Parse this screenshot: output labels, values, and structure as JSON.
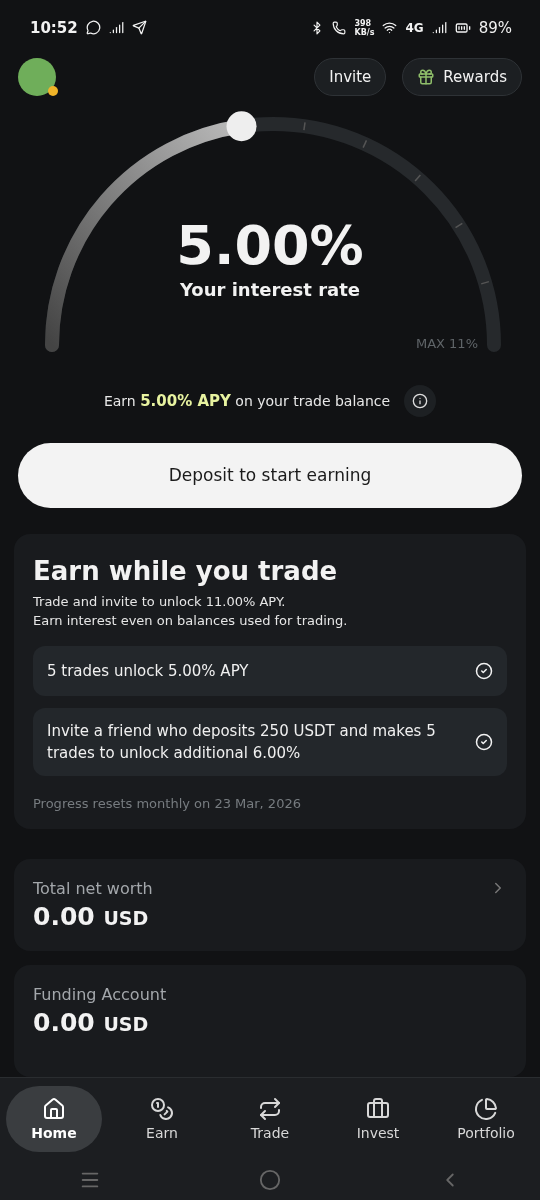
{
  "status_bar": {
    "time": "10:52",
    "speed_value": "398",
    "speed_unit": "KB/s",
    "network": "4G",
    "battery": "89%"
  },
  "header": {
    "buttons": [
      {
        "kind": "plain",
        "label": "Invite"
      },
      {
        "kind": "gift",
        "label": "Rewards"
      }
    ]
  },
  "gauge": {
    "rate": "5.00%",
    "caption": "Your interest rate",
    "max_label": "MAX 11%",
    "level": 0.4545
  },
  "apy_note": "Earn **5.00% APY** on your trade balance",
  "deposit_button": "Deposit to start earning",
  "earn_card": {
    "title": "Earn while you trade",
    "subtitle": "Trade and invite to unlock 11.00% APY.\nEarn interest even on balances used for trading.",
    "tasks": [
      {
        "label": "5 trades unlock 5.00% APY",
        "checked": true
      },
      {
        "label": "Invite a friend who deposits 250 USDT and makes 5 trades to unlock additional 6.00%",
        "checked": true
      }
    ],
    "footnote": "Progress resets monthly on 23 Mar, 2026"
  },
  "accounts": [
    {
      "label": "Total net worth",
      "amount": "0.00",
      "currency": "USD",
      "chevron": true
    },
    {
      "label": "Funding Account",
      "amount": "0.00",
      "currency": "USD",
      "chevron": false
    }
  ],
  "bottom_nav": [
    {
      "kind": "home",
      "label": "Home",
      "selected": true
    },
    {
      "kind": "earn",
      "label": "Earn",
      "selected": false
    },
    {
      "kind": "trade",
      "label": "Trade",
      "selected": false
    },
    {
      "kind": "invest",
      "label": "Invest",
      "selected": false
    },
    {
      "kind": "portfolio",
      "label": "Portfolio",
      "selected": false
    }
  ]
}
